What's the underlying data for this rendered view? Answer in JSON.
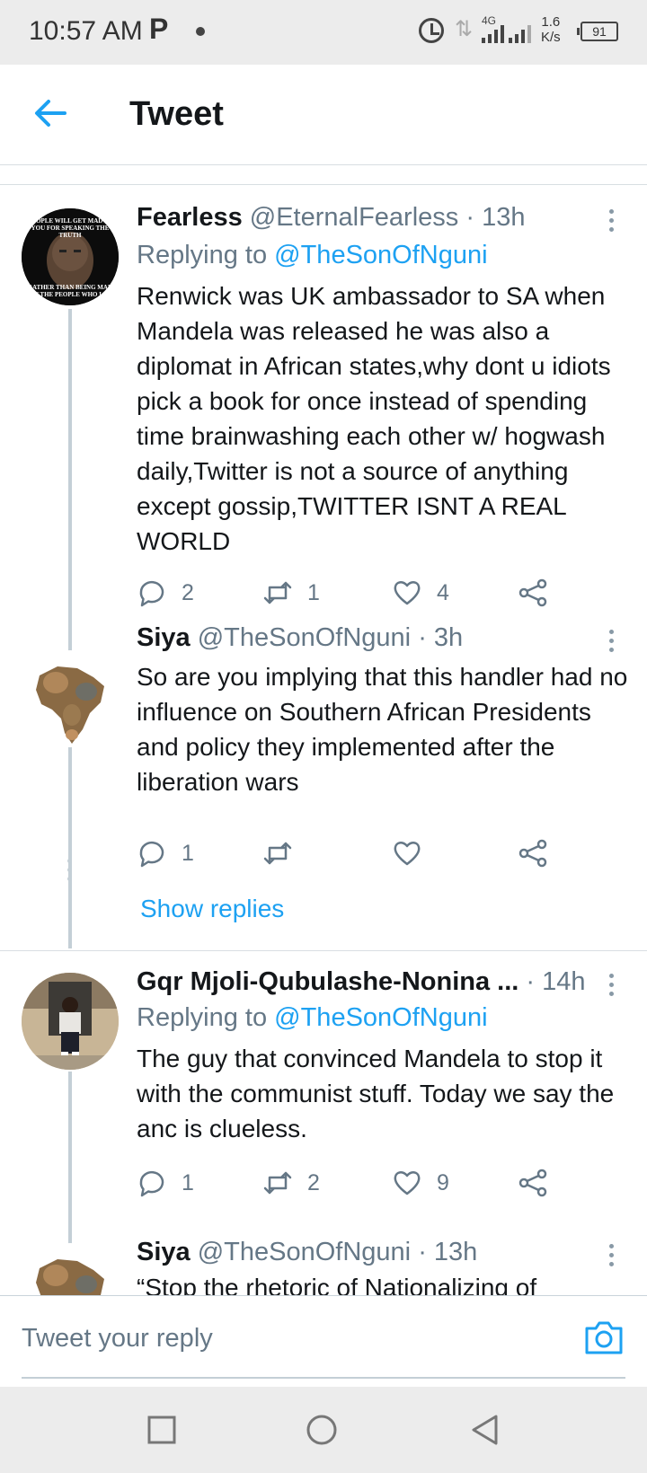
{
  "status_bar": {
    "time": "10:57 AM",
    "app_indicator": "P",
    "network": "4G",
    "speed_value": "1.6",
    "speed_unit": "K/s",
    "battery": "91"
  },
  "header": {
    "title": "Tweet",
    "accent_color": "#1da1f2"
  },
  "tweets": [
    {
      "name": "Fearless",
      "handle": "@EternalFearless",
      "time": "· 13h",
      "replying_prefix": "Replying to",
      "replying_to": "@TheSonOfNguni",
      "text": "Renwick was UK ambassador to SA when Mandela was released he was also a diplomat in African states,why dont u idiots pick a book for once instead of spending time brainwashing each other w/ hogwash daily,Twitter is not a source of anything except gossip,TWITTER ISNT A REAL WORLD",
      "replies": "2",
      "retweets": "1",
      "likes": "4",
      "avatar_text_top": "PEOPLE WILL GET MAD AT YOU FOR SPEAKING THE TRUTH",
      "avatar_text_bottom": "RATHER THAN BEING MAD AT THE PEOPLE WHO LIE"
    },
    {
      "name": "Siya",
      "handle": "@TheSonOfNguni",
      "time": "· 3h",
      "text": "So are you implying that this handler had no influence on Southern African Presidents and policy they implemented after the liberation wars",
      "replies": "1",
      "retweets": "",
      "likes": "",
      "show_replies": "Show replies"
    },
    {
      "name": "Gqr Mjoli-Qubulashe-Nonina ...",
      "handle": "",
      "time": "· 14h",
      "replying_prefix": "Replying to",
      "replying_to": "@TheSonOfNguni",
      "text": "The guy that convinced Mandela to stop it with the communist stuff. Today we say the anc is clueless.",
      "replies": "1",
      "retweets": "2",
      "likes": "9"
    },
    {
      "name": "Siya",
      "handle": "@TheSonOfNguni",
      "time": "· 13h",
      "text": "“Stop the rhetoric of Nationalizing of"
    }
  ],
  "reply_bar": {
    "placeholder": "Tweet your reply"
  },
  "icons": {
    "back": "arrow-left-icon",
    "more": "more-vertical-icon",
    "reply": "comment-icon",
    "retweet": "retweet-icon",
    "like": "heart-icon",
    "share": "share-icon",
    "camera": "camera-icon",
    "nav_recents": "square-icon",
    "nav_home": "circle-icon",
    "nav_back": "triangle-back-icon"
  }
}
